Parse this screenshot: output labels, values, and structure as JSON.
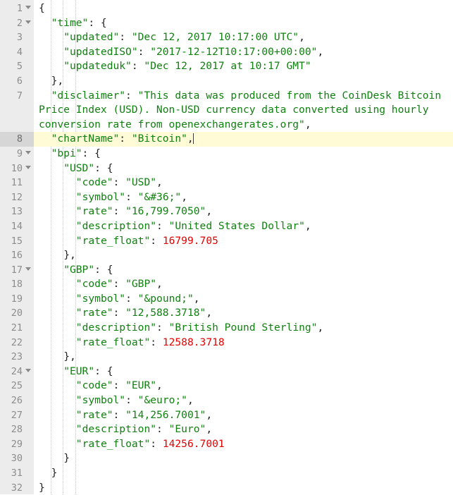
{
  "editor": {
    "language": "JSON",
    "active_line": 8,
    "total_lines": 32,
    "colors": {
      "background": "#ffffff",
      "gutter_background": "#ececec",
      "gutter_active": "#d6d6d6",
      "line_number": "#8c8c8c",
      "active_line_highlight": "#fffbd6",
      "string": "#108010",
      "number": "#e60000",
      "punctuation": "#222222",
      "indent_guide": "#c8c8c8",
      "caret": "#3a3a3a"
    }
  },
  "gutter": {
    "numbers": [
      "1",
      "2",
      "3",
      "4",
      "5",
      "6",
      "7",
      "",
      "",
      "8",
      "9",
      "10",
      "11",
      "12",
      "13",
      "14",
      "15",
      "16",
      "17",
      "18",
      "19",
      "20",
      "21",
      "22",
      "23",
      "24",
      "25",
      "26",
      "27",
      "28",
      "29",
      "30",
      "31",
      "32"
    ],
    "fold_lines": [
      "1",
      "2",
      "9",
      "10",
      "17",
      "24"
    ]
  },
  "lines": [
    {
      "n": "1",
      "indent": 0,
      "tokens": [
        {
          "t": "punc",
          "v": "{"
        }
      ]
    },
    {
      "n": "2",
      "indent": 1,
      "tokens": [
        {
          "t": "str",
          "v": "\"time\""
        },
        {
          "t": "punc",
          "v": ": {"
        }
      ]
    },
    {
      "n": "3",
      "indent": 2,
      "tokens": [
        {
          "t": "str",
          "v": "\"updated\""
        },
        {
          "t": "punc",
          "v": ": "
        },
        {
          "t": "str",
          "v": "\"Dec 12, 2017 10:17:00 UTC\""
        },
        {
          "t": "punc",
          "v": ","
        }
      ]
    },
    {
      "n": "4",
      "indent": 2,
      "tokens": [
        {
          "t": "str",
          "v": "\"updatedISO\""
        },
        {
          "t": "punc",
          "v": ": "
        },
        {
          "t": "str",
          "v": "\"2017-12-12T10:17:00+00:00\""
        },
        {
          "t": "punc",
          "v": ","
        }
      ]
    },
    {
      "n": "5",
      "indent": 2,
      "tokens": [
        {
          "t": "str",
          "v": "\"updateduk\""
        },
        {
          "t": "punc",
          "v": ": "
        },
        {
          "t": "str",
          "v": "\"Dec 12, 2017 at 10:17 GMT\""
        }
      ]
    },
    {
      "n": "6",
      "indent": 1,
      "tokens": [
        {
          "t": "punc",
          "v": "},"
        }
      ]
    },
    {
      "n": "7",
      "indent": 1,
      "wrap": true,
      "tokens": [
        {
          "t": "str",
          "v": "\"disclaimer\""
        },
        {
          "t": "punc",
          "v": ": "
        },
        {
          "t": "str",
          "v": "\"This data was produced from the CoinDesk Bitcoin"
        }
      ]
    },
    {
      "n": "",
      "indent": 0,
      "cont": true,
      "tokens": [
        {
          "t": "str",
          "v": "Price Index (USD). Non-USD currency data converted using hourly"
        }
      ]
    },
    {
      "n": "",
      "indent": 0,
      "cont": true,
      "tokens": [
        {
          "t": "str",
          "v": "conversion rate from openexchangerates.org\""
        },
        {
          "t": "punc",
          "v": ","
        }
      ]
    },
    {
      "n": "8",
      "indent": 1,
      "active": true,
      "caret": true,
      "tokens": [
        {
          "t": "str",
          "v": "\"chartName\""
        },
        {
          "t": "punc",
          "v": ": "
        },
        {
          "t": "str",
          "v": "\"Bitcoin\""
        },
        {
          "t": "punc",
          "v": ","
        }
      ]
    },
    {
      "n": "9",
      "indent": 1,
      "tokens": [
        {
          "t": "str",
          "v": "\"bpi\""
        },
        {
          "t": "punc",
          "v": ": {"
        }
      ]
    },
    {
      "n": "10",
      "indent": 2,
      "tokens": [
        {
          "t": "str",
          "v": "\"USD\""
        },
        {
          "t": "punc",
          "v": ": {"
        }
      ]
    },
    {
      "n": "11",
      "indent": 3,
      "tokens": [
        {
          "t": "str",
          "v": "\"code\""
        },
        {
          "t": "punc",
          "v": ": "
        },
        {
          "t": "str",
          "v": "\"USD\""
        },
        {
          "t": "punc",
          "v": ","
        }
      ]
    },
    {
      "n": "12",
      "indent": 3,
      "tokens": [
        {
          "t": "str",
          "v": "\"symbol\""
        },
        {
          "t": "punc",
          "v": ": "
        },
        {
          "t": "str",
          "v": "\"&#36;\""
        },
        {
          "t": "punc",
          "v": ","
        }
      ]
    },
    {
      "n": "13",
      "indent": 3,
      "tokens": [
        {
          "t": "str",
          "v": "\"rate\""
        },
        {
          "t": "punc",
          "v": ": "
        },
        {
          "t": "str",
          "v": "\"16,799.7050\""
        },
        {
          "t": "punc",
          "v": ","
        }
      ]
    },
    {
      "n": "14",
      "indent": 3,
      "tokens": [
        {
          "t": "str",
          "v": "\"description\""
        },
        {
          "t": "punc",
          "v": ": "
        },
        {
          "t": "str",
          "v": "\"United States Dollar\""
        },
        {
          "t": "punc",
          "v": ","
        }
      ]
    },
    {
      "n": "15",
      "indent": 3,
      "tokens": [
        {
          "t": "str",
          "v": "\"rate_float\""
        },
        {
          "t": "punc",
          "v": ": "
        },
        {
          "t": "num",
          "v": "16799.705"
        }
      ]
    },
    {
      "n": "16",
      "indent": 2,
      "tokens": [
        {
          "t": "punc",
          "v": "},"
        }
      ]
    },
    {
      "n": "17",
      "indent": 2,
      "tokens": [
        {
          "t": "str",
          "v": "\"GBP\""
        },
        {
          "t": "punc",
          "v": ": {"
        }
      ]
    },
    {
      "n": "18",
      "indent": 3,
      "tokens": [
        {
          "t": "str",
          "v": "\"code\""
        },
        {
          "t": "punc",
          "v": ": "
        },
        {
          "t": "str",
          "v": "\"GBP\""
        },
        {
          "t": "punc",
          "v": ","
        }
      ]
    },
    {
      "n": "19",
      "indent": 3,
      "tokens": [
        {
          "t": "str",
          "v": "\"symbol\""
        },
        {
          "t": "punc",
          "v": ": "
        },
        {
          "t": "str",
          "v": "\"&pound;\""
        },
        {
          "t": "punc",
          "v": ","
        }
      ]
    },
    {
      "n": "20",
      "indent": 3,
      "tokens": [
        {
          "t": "str",
          "v": "\"rate\""
        },
        {
          "t": "punc",
          "v": ": "
        },
        {
          "t": "str",
          "v": "\"12,588.3718\""
        },
        {
          "t": "punc",
          "v": ","
        }
      ]
    },
    {
      "n": "21",
      "indent": 3,
      "tokens": [
        {
          "t": "str",
          "v": "\"description\""
        },
        {
          "t": "punc",
          "v": ": "
        },
        {
          "t": "str",
          "v": "\"British Pound Sterling\""
        },
        {
          "t": "punc",
          "v": ","
        }
      ]
    },
    {
      "n": "22",
      "indent": 3,
      "tokens": [
        {
          "t": "str",
          "v": "\"rate_float\""
        },
        {
          "t": "punc",
          "v": ": "
        },
        {
          "t": "num",
          "v": "12588.3718"
        }
      ]
    },
    {
      "n": "23",
      "indent": 2,
      "tokens": [
        {
          "t": "punc",
          "v": "},"
        }
      ]
    },
    {
      "n": "24",
      "indent": 2,
      "tokens": [
        {
          "t": "str",
          "v": "\"EUR\""
        },
        {
          "t": "punc",
          "v": ": {"
        }
      ]
    },
    {
      "n": "25",
      "indent": 3,
      "tokens": [
        {
          "t": "str",
          "v": "\"code\""
        },
        {
          "t": "punc",
          "v": ": "
        },
        {
          "t": "str",
          "v": "\"EUR\""
        },
        {
          "t": "punc",
          "v": ","
        }
      ]
    },
    {
      "n": "26",
      "indent": 3,
      "tokens": [
        {
          "t": "str",
          "v": "\"symbol\""
        },
        {
          "t": "punc",
          "v": ": "
        },
        {
          "t": "str",
          "v": "\"&euro;\""
        },
        {
          "t": "punc",
          "v": ","
        }
      ]
    },
    {
      "n": "27",
      "indent": 3,
      "tokens": [
        {
          "t": "str",
          "v": "\"rate\""
        },
        {
          "t": "punc",
          "v": ": "
        },
        {
          "t": "str",
          "v": "\"14,256.7001\""
        },
        {
          "t": "punc",
          "v": ","
        }
      ]
    },
    {
      "n": "28",
      "indent": 3,
      "tokens": [
        {
          "t": "str",
          "v": "\"description\""
        },
        {
          "t": "punc",
          "v": ": "
        },
        {
          "t": "str",
          "v": "\"Euro\""
        },
        {
          "t": "punc",
          "v": ","
        }
      ]
    },
    {
      "n": "29",
      "indent": 3,
      "tokens": [
        {
          "t": "str",
          "v": "\"rate_float\""
        },
        {
          "t": "punc",
          "v": ": "
        },
        {
          "t": "num",
          "v": "14256.7001"
        }
      ]
    },
    {
      "n": "30",
      "indent": 2,
      "tokens": [
        {
          "t": "punc",
          "v": "}"
        }
      ]
    },
    {
      "n": "31",
      "indent": 1,
      "tokens": [
        {
          "t": "punc",
          "v": "}"
        }
      ]
    },
    {
      "n": "32",
      "indent": 0,
      "tokens": [
        {
          "t": "punc",
          "v": "}"
        }
      ]
    }
  ],
  "document_values": {
    "time": {
      "updated": "Dec 12, 2017 10:17:00 UTC",
      "updatedISO": "2017-12-12T10:17:00+00:00",
      "updateduk": "Dec 12, 2017 at 10:17 GMT"
    },
    "disclaimer": "This data was produced from the CoinDesk Bitcoin Price Index (USD). Non-USD currency data converted using hourly conversion rate from openexchangerates.org",
    "chartName": "Bitcoin",
    "bpi": {
      "USD": {
        "code": "USD",
        "symbol": "&#36;",
        "rate": "16,799.7050",
        "description": "United States Dollar",
        "rate_float": "16799.705"
      },
      "GBP": {
        "code": "GBP",
        "symbol": "&pound;",
        "rate": "12,588.3718",
        "description": "British Pound Sterling",
        "rate_float": "12588.3718"
      },
      "EUR": {
        "code": "EUR",
        "symbol": "&euro;",
        "rate": "14,256.7001",
        "description": "Euro",
        "rate_float": "14256.7001"
      }
    }
  }
}
